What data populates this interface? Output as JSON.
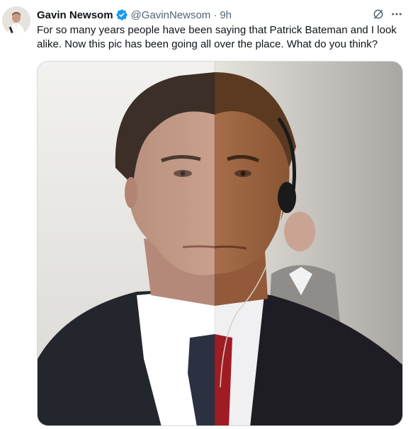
{
  "tweet": {
    "author_name": "Gavin Newsom",
    "handle": "@GavinNewsom",
    "separator": "·",
    "time": "9h",
    "text": "For so many years people have been saying that Patrick Bateman and I look alike. Now this pic has been going all over the place. What do you think?",
    "icons": {
      "avatar": "profile-photo",
      "verified": "verified-badge-icon",
      "grok": "grok-icon",
      "more": "more-options-icon"
    },
    "colors": {
      "verified": "#1d9bf0",
      "secondary_text": "#536471",
      "primary_text": "#0f1419"
    }
  }
}
